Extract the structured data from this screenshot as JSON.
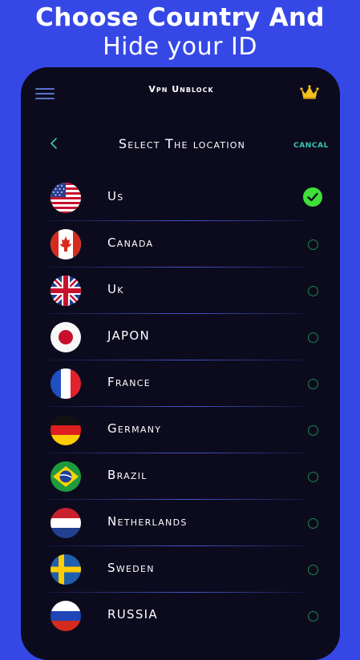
{
  "promo": {
    "line1": "Choose Country And",
    "line2": "Hide your ID"
  },
  "header": {
    "title": "Vpn Unblock",
    "menu_icon": "hamburger-icon",
    "premium_icon": "crown-icon"
  },
  "selection": {
    "title": "Select The location",
    "back_icon": "chevron-left-icon",
    "cancel_label": "CANCAL"
  },
  "locations": [
    {
      "name": "Us",
      "selected": true
    },
    {
      "name": "Canada",
      "selected": false
    },
    {
      "name": "Uk",
      "selected": false
    },
    {
      "name": "JAPON",
      "selected": false
    },
    {
      "name": "France",
      "selected": false
    },
    {
      "name": "Germany",
      "selected": false
    },
    {
      "name": "Brazil",
      "selected": false
    },
    {
      "name": "Netherlands",
      "selected": false
    },
    {
      "name": "Sweden",
      "selected": false
    },
    {
      "name": "RUSSIA",
      "selected": false
    }
  ],
  "colors": {
    "background": "#3548e6",
    "panel": "#0c0b1e",
    "accent": "#39c6b3",
    "selected": "#3fe038",
    "radio": "#1b8a45"
  }
}
